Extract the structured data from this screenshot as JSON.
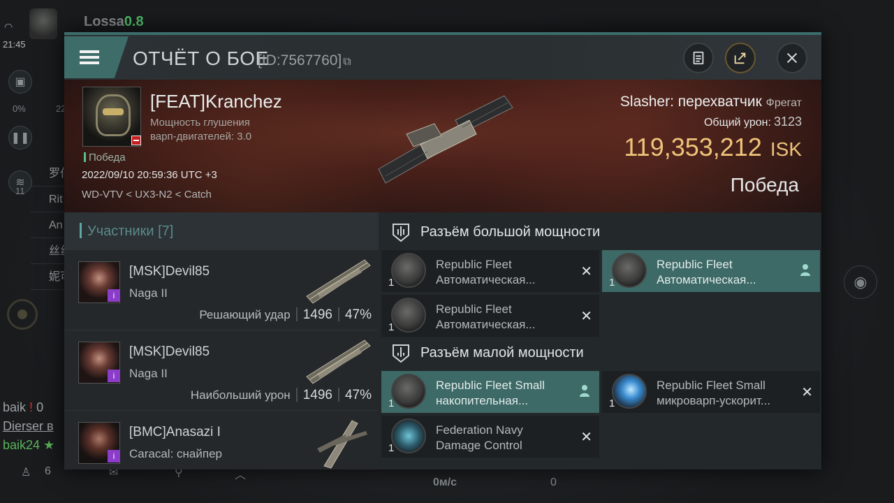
{
  "background": {
    "pilot_name": "Lossa",
    "security_status": "0.8",
    "clock": "21:45",
    "left_percent": "0%",
    "left_number": "22",
    "overview_badge": "11",
    "list_items": [
      "罗伯",
      "Rit",
      "An",
      "丝丝",
      "妮可"
    ],
    "chat_lines": [
      {
        "name": "baik",
        "suffix": "0"
      },
      {
        "name": "Dierser",
        "suffix": "в"
      },
      {
        "name": "baik24",
        "suffix": "★"
      }
    ],
    "bottom_count": "6",
    "speed": "0м/с",
    "bottom_zero": "0",
    "local_flag": "!"
  },
  "modal": {
    "title": "ОТЧЁТ О БОЕ",
    "report_id": "[ID:7567760]",
    "copy_icon": "copy-icon",
    "buttons": {
      "notes": "clipboard-icon",
      "share": "share-icon",
      "close": "close-icon"
    }
  },
  "victim": {
    "name": "[FEAT]Kranchez",
    "attribute_line1": "Мощность глушения",
    "attribute_line2": "варп-двигателей: 3.0",
    "outcome_tag": "Победа",
    "datetime": "2022/09/10 20:59:36 UTC +3",
    "location": "WD-VTV < UX3-N2 < Catch",
    "ship": "Slasher: перехватчик",
    "ship_class": "Фрегат",
    "total_damage_label": "Общий урон:",
    "total_damage": "3123",
    "isk_value": "119,353,212",
    "isk_unit": "ISK",
    "result": "Победа"
  },
  "participants": {
    "header": "Участники [7]",
    "rows": [
      {
        "name": "[MSK]Devil85",
        "ship": "Naga II",
        "role": "Решающий удар",
        "damage": "1496",
        "percent": "47%"
      },
      {
        "name": "[MSK]Devil85",
        "ship": "Naga II",
        "role": "Наибольший урон",
        "damage": "1496",
        "percent": "47%"
      },
      {
        "name": "[BMC]Anasazi I",
        "ship": "Caracal: снайпер",
        "role": "",
        "damage": "",
        "percent": ""
      }
    ]
  },
  "fittings": {
    "high_slot_header": "Разъём большой мощности",
    "low_slot_header": "Разъём малой мощности",
    "high": [
      {
        "line1": "Republic Fleet",
        "line2": "Автоматическая...",
        "qty": "1",
        "state": "dropped"
      },
      {
        "line1": "Republic Fleet",
        "line2": "Автоматическая...",
        "qty": "1",
        "state": "kept"
      },
      {
        "line1": "Republic Fleet",
        "line2": "Автоматическая...",
        "qty": "1",
        "state": "dropped"
      }
    ],
    "low": [
      {
        "line1": "Republic Fleet Small",
        "line2": "накопительная...",
        "qty": "1",
        "state": "kept"
      },
      {
        "line1": "Republic Fleet Small",
        "line2": "микроварп-ускорит...",
        "qty": "1",
        "state": "dropped"
      },
      {
        "line1": "Federation Navy",
        "line2": "Damage Control",
        "qty": "1",
        "state": "dropped"
      }
    ]
  }
}
